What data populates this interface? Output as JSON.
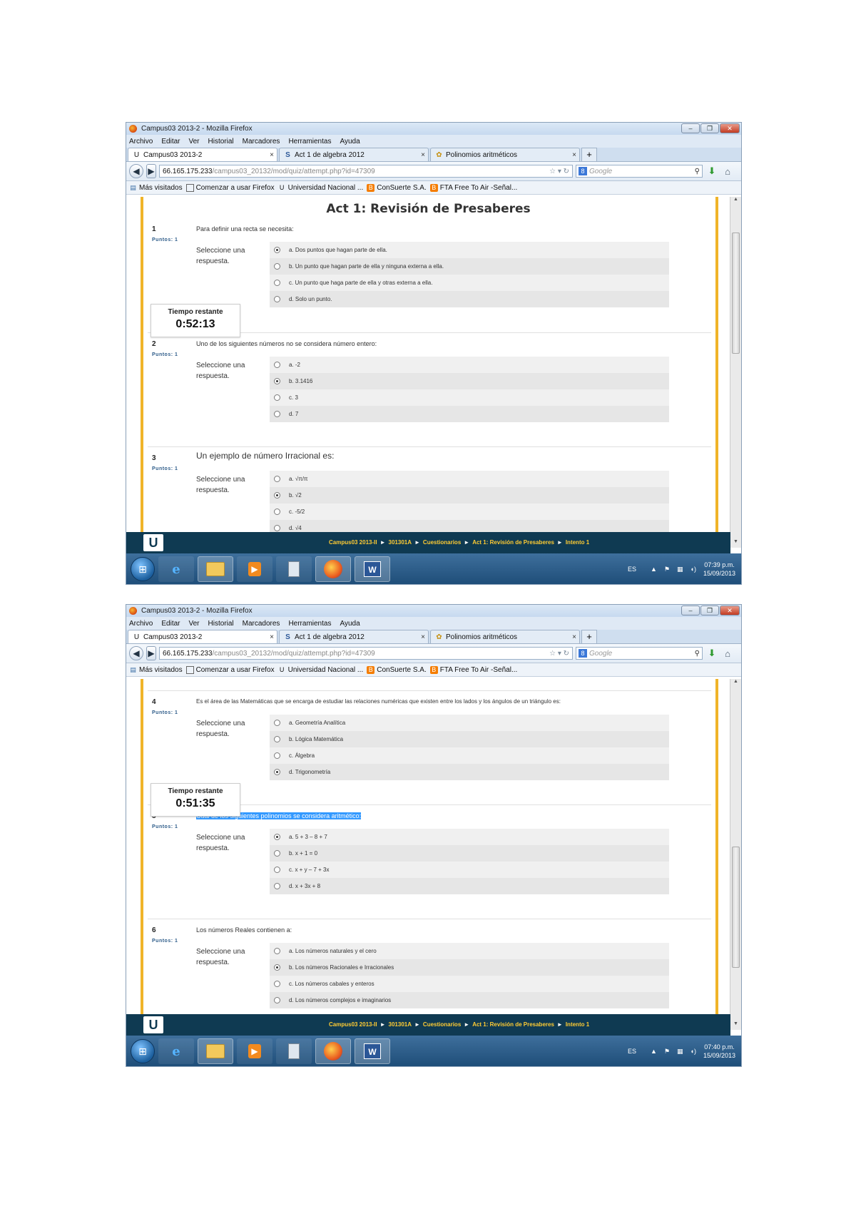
{
  "browser": {
    "window_title": "Campus03 2013-2 - Mozilla Firefox",
    "menu": [
      "Archivo",
      "Editar",
      "Ver",
      "Historial",
      "Marcadores",
      "Herramientas",
      "Ayuda"
    ],
    "tabs": [
      {
        "label": "Campus03 2013-2",
        "icon": "U"
      },
      {
        "label": "Act 1 de algebra 2012",
        "icon": "S"
      },
      {
        "label": "Polinomios aritméticos",
        "icon": "✿"
      }
    ],
    "new_tab_symbol": "+",
    "url_host": "66.165.175.233",
    "url_path": "/campus03_20132/mod/quiz/attempt.php?id=47309",
    "search_placeholder": "Google",
    "bookmarks": [
      "Más visitados",
      "Comenzar a usar Firefox",
      "Universidad Nacional ...",
      "ConSuerte S.A.",
      "FTA Free To Air -Señal..."
    ]
  },
  "page": {
    "title": "Act 1: Revisión de Presaberes",
    "points_label": "Puntos: 1",
    "prompt": "Seleccione una respuesta.",
    "timer_label": "Tiempo restante",
    "breadcrumb": [
      "Campus03 2013-II",
      "301301A",
      "Cuestionarios",
      "Act 1: Revisión de Presaberes",
      "Intento 1"
    ],
    "logo_letter": "U"
  },
  "screen1": {
    "timer_value": "0:52:13",
    "clock_time": "07:39 p.m.",
    "clock_date": "15/09/2013",
    "questions": [
      {
        "num": "1",
        "text": "Para definir una recta se necesita:",
        "answers": [
          "a. Dos puntos que hagan parte de ella.",
          "b. Un punto que hagan parte de ella y ninguna externa a ella.",
          "c. Un punto que haga parte de ella y otras externa a ella.",
          "d. Solo un punto."
        ],
        "selected": 0
      },
      {
        "num": "2",
        "text": "Uno de los siguientes números no se considera número entero:",
        "answers": [
          "a. -2",
          "b. 3.1416",
          "c. 3",
          "d. 7"
        ],
        "selected": 1
      },
      {
        "num": "3",
        "text": "Un ejemplo de número Irracional es:",
        "answers": [
          "a. √π/π",
          "b. √2",
          "c. -5/2",
          "d. √4"
        ],
        "selected": 1
      }
    ]
  },
  "screen2": {
    "timer_value": "0:51:35",
    "clock_time": "07:40 p.m.",
    "clock_date": "15/09/2013",
    "questions": [
      {
        "num": "4",
        "text": "Es el área de las Matemáticas que se encarga de estudiar las relaciones numéricas que existen entre los lados y los ángulos de un triángulo es:",
        "answers": [
          "a. Geometría Analítica",
          "b. Lógica Matemática",
          "c. Álgebra",
          "d. Trigonometría"
        ],
        "selected": 3
      },
      {
        "num": "5",
        "text": "Cuál de los siguientes polinomios se considera aritmético:",
        "answers": [
          "a. 5 + 3 – 8 + 7",
          "b. x + 1 = 0",
          "c. x + y – 7 + 3x",
          "d. x + 3x + 8"
        ],
        "selected": 0
      },
      {
        "num": "6",
        "text": "Los números Reales contienen a:",
        "answers": [
          "a. Los números naturales y el cero",
          "b. Los números Racionales e Irracionales",
          "c. Los números cabales y enteros",
          "d. Los números complejos e imaginarios"
        ],
        "selected": 1
      }
    ]
  },
  "taskbar": {
    "lang": "ES",
    "start_symbol": "⊞",
    "ie_symbol": "e"
  }
}
